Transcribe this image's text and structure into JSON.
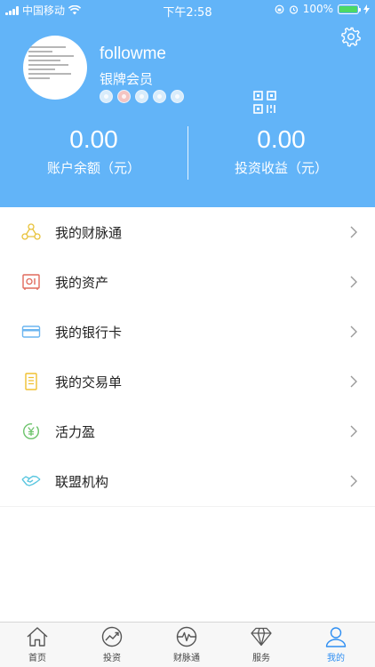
{
  "status_bar": {
    "carrier": "中国移动",
    "time": "下午2:58",
    "battery_percent": "100%"
  },
  "profile": {
    "username": "followme",
    "level": "银牌会员",
    "badges": [
      "badge-1",
      "badge-2",
      "badge-3",
      "badge-4",
      "badge-5"
    ]
  },
  "balance": {
    "account_amount": "0.00",
    "account_label": "账户余额（元）",
    "earnings_amount": "0.00",
    "earnings_label": "投资收益（元）"
  },
  "menu": {
    "items": [
      {
        "label": "我的财脉通",
        "icon": "network-icon",
        "color": "#e8c23a"
      },
      {
        "label": "我的资产",
        "icon": "safe-icon",
        "color": "#e06a5c"
      },
      {
        "label": "我的银行卡",
        "icon": "card-icon",
        "color": "#6cb6f0"
      },
      {
        "label": "我的交易单",
        "icon": "receipt-icon",
        "color": "#f0c030"
      },
      {
        "label": "活力盈",
        "icon": "yen-coin-icon",
        "color": "#6cc36b"
      },
      {
        "label": "联盟机构",
        "icon": "handshake-icon",
        "color": "#5cc7e0"
      }
    ]
  },
  "tabbar": {
    "tabs": [
      {
        "label": "首页",
        "icon": "home-icon"
      },
      {
        "label": "投资",
        "icon": "trend-icon"
      },
      {
        "label": "财脉通",
        "icon": "pulse-icon"
      },
      {
        "label": "服务",
        "icon": "diamond-icon"
      },
      {
        "label": "我的",
        "icon": "person-icon"
      }
    ],
    "active_index": 4
  },
  "colors": {
    "header_bg": "#62b4f8",
    "active_tab": "#2e8ef2"
  }
}
